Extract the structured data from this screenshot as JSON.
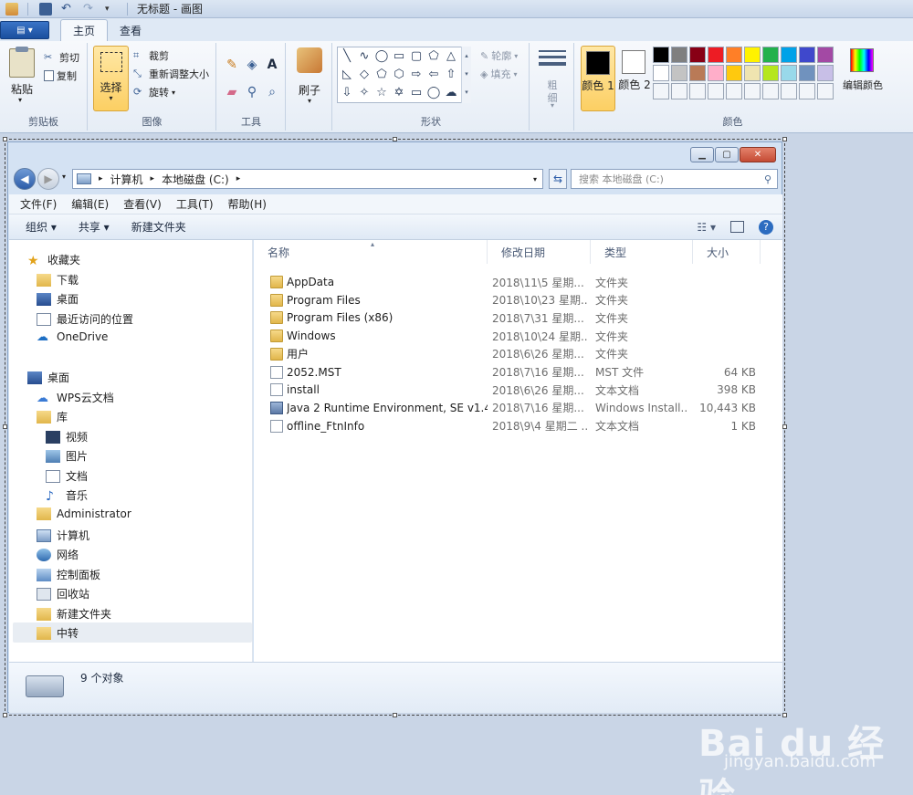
{
  "titlebar": {
    "title": "无标题 - 画图"
  },
  "tabs": [
    {
      "label": "主页"
    },
    {
      "label": "查看"
    }
  ],
  "menu_button": {
    "icon": "menu-icon"
  },
  "ribbon": {
    "clipboard": {
      "paste": "粘贴",
      "cut": "剪切",
      "copy": "复制",
      "group": "剪贴板"
    },
    "image": {
      "select": "选择",
      "crop": "裁剪",
      "resize": "重新调整大小",
      "rotate": "旋转",
      "group": "图像"
    },
    "tools": {
      "group": "工具",
      "brush": "刷子"
    },
    "shapes": {
      "outline": "轮廓",
      "fill": "填充",
      "group": "形状"
    },
    "size": {
      "label1": "粗",
      "label2": "细"
    },
    "colors": {
      "color1_label": "颜色 1",
      "color2_label": "颜色 2",
      "edit": "编辑颜色",
      "group": "颜色",
      "color1": "#000000",
      "color2": "#ffffff",
      "palette_row1": [
        "#000000",
        "#7f7f7f",
        "#880015",
        "#ed1c24",
        "#ff7f27",
        "#fff200",
        "#22b14c",
        "#00a2e8",
        "#3f48cc",
        "#a349a4"
      ],
      "palette_row2": [
        "#ffffff",
        "#c3c3c3",
        "#b97a57",
        "#ffaec9",
        "#ffc90e",
        "#efe4b0",
        "#b5e61d",
        "#99d9ea",
        "#7092be",
        "#c8bfe7"
      ]
    }
  },
  "explorer": {
    "breadcrumb": [
      "计算机",
      "本地磁盘 (C:)"
    ],
    "search_placeholder": "搜索 本地磁盘 (C:)",
    "menus": [
      "文件(F)",
      "编辑(E)",
      "查看(V)",
      "工具(T)",
      "帮助(H)"
    ],
    "commands": {
      "organize": "组织 ▾",
      "share": "共享 ▾",
      "new_folder": "新建文件夹"
    },
    "nav": {
      "favorites": "收藏夹",
      "downloads": "下载",
      "desktop_fav": "桌面",
      "recent": "最近访问的位置",
      "onedrive": "OneDrive",
      "desktop": "桌面",
      "wps": "WPS云文档",
      "library": "库",
      "video": "视频",
      "pictures": "图片",
      "documents": "文档",
      "music": "音乐",
      "administrator": "Administrator",
      "computer": "计算机",
      "network": "网络",
      "control_panel": "控制面板",
      "recycle": "回收站",
      "new_folder": "新建文件夹",
      "transfer": "中转"
    },
    "columns": {
      "name": "名称",
      "date": "修改日期",
      "type": "类型",
      "size": "大小"
    },
    "files": [
      {
        "name": "AppData",
        "date": "2018\\11\\5 星期...",
        "type": "文件夹",
        "size": "",
        "icon": "folder"
      },
      {
        "name": "Program Files",
        "date": "2018\\10\\23 星期...",
        "type": "文件夹",
        "size": "",
        "icon": "folder"
      },
      {
        "name": "Program Files (x86)",
        "date": "2018\\7\\31 星期...",
        "type": "文件夹",
        "size": "",
        "icon": "folder"
      },
      {
        "name": "Windows",
        "date": "2018\\10\\24 星期...",
        "type": "文件夹",
        "size": "",
        "icon": "folder"
      },
      {
        "name": "用户",
        "date": "2018\\6\\26 星期...",
        "type": "文件夹",
        "size": "",
        "icon": "folder"
      },
      {
        "name": "2052.MST",
        "date": "2018\\7\\16 星期...",
        "type": "MST 文件",
        "size": "64 KB",
        "icon": "file"
      },
      {
        "name": "install",
        "date": "2018\\6\\26 星期...",
        "type": "文本文档",
        "size": "398 KB",
        "icon": "file"
      },
      {
        "name": "Java 2 Runtime Environment, SE v1.4....",
        "date": "2018\\7\\16 星期...",
        "type": "Windows Install...",
        "size": "10,443 KB",
        "icon": "installer"
      },
      {
        "name": "offline_FtnInfo",
        "date": "2018\\9\\4 星期二 ...",
        "type": "文本文档",
        "size": "1 KB",
        "icon": "file"
      }
    ],
    "status": "9 个对象"
  },
  "watermark": {
    "logo": "Bai du 经验",
    "url": "jingyan.baidu.com"
  }
}
